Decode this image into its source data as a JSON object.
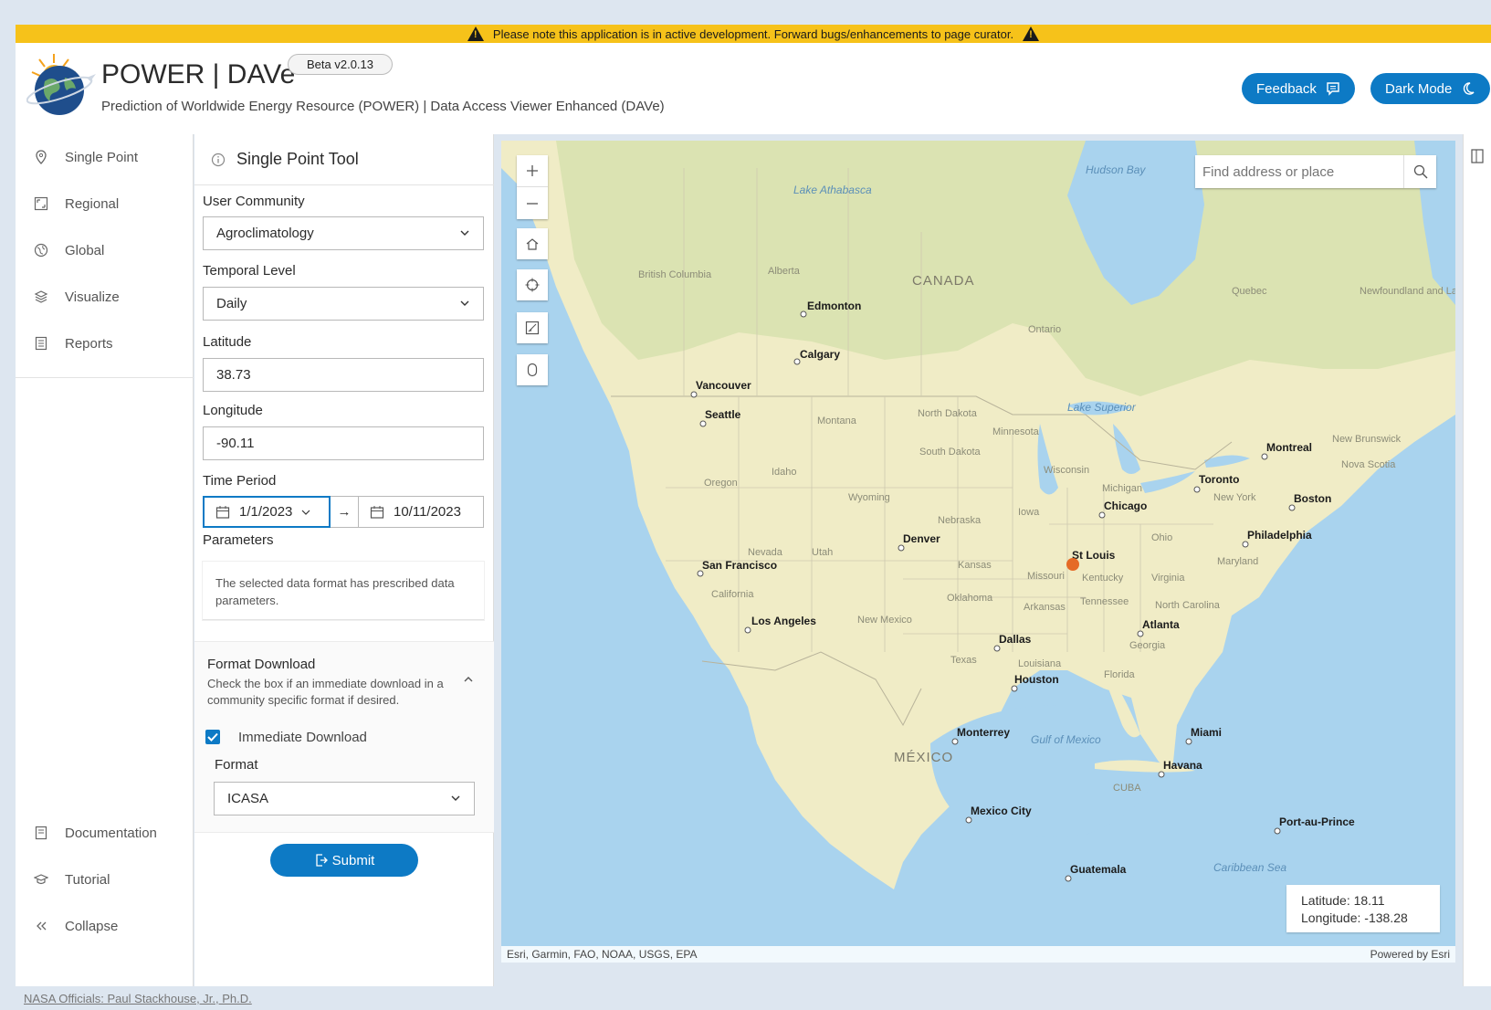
{
  "banner": {
    "text": "Please note this application is in active development. Forward bugs/enhancements to page curator."
  },
  "header": {
    "title": "POWER | DAVe",
    "beta": "Beta v2.0.13",
    "subtitle": "Prediction of Worldwide Energy Resource (POWER) | Data Access Viewer Enhanced (DAVe)",
    "feedback_label": "Feedback",
    "darkmode_label": "Dark Mode"
  },
  "sidebar": {
    "items": [
      {
        "label": "Single Point",
        "icon": "map-pin-icon"
      },
      {
        "label": "Regional",
        "icon": "region-icon"
      },
      {
        "label": "Global",
        "icon": "globe-icon"
      },
      {
        "label": "Visualize",
        "icon": "layers-icon"
      },
      {
        "label": "Reports",
        "icon": "report-icon"
      }
    ],
    "bottom": [
      {
        "label": "Documentation",
        "icon": "document-icon"
      },
      {
        "label": "Tutorial",
        "icon": "graduation-cap-icon"
      },
      {
        "label": "Collapse",
        "icon": "double-chevron-left-icon"
      }
    ]
  },
  "tool": {
    "title": "Single Point Tool",
    "user_community": {
      "label": "User Community",
      "value": "Agroclimatology"
    },
    "temporal_level": {
      "label": "Temporal Level",
      "value": "Daily"
    },
    "latitude": {
      "label": "Latitude",
      "value": "38.73"
    },
    "longitude": {
      "label": "Longitude",
      "value": "-90.11"
    },
    "time_period": {
      "label": "Time Period",
      "start": "1/1/2023",
      "end": "10/11/2023"
    },
    "parameters": {
      "label": "Parameters",
      "note": "The selected data format has prescribed data parameters."
    },
    "format_download": {
      "title": "Format Download",
      "desc": "Check the box if an immediate download in a community specific format if desired.",
      "checkbox_label": "Immediate Download",
      "checked": true,
      "format_label": "Format",
      "format_value": "ICASA"
    },
    "submit_label": "Submit"
  },
  "map": {
    "search_placeholder": "Find address or place",
    "coords": {
      "lat": "Latitude: 18.11",
      "lon": "Longitude: -138.28"
    },
    "attribution": "Esri, Garmin, FAO, NOAA, USGS, EPA",
    "powered": "Powered by Esri",
    "cities": [
      "Edmonton",
      "Calgary",
      "Vancouver",
      "Seattle",
      "San Francisco",
      "Los Angeles",
      "Denver",
      "Dallas",
      "Houston",
      "St Louis",
      "Chicago",
      "Toronto",
      "Montreal",
      "Boston",
      "Philadelphia",
      "Atlanta",
      "Miami",
      "Havana",
      "Monterrey",
      "Mexico City",
      "Guatemala",
      "Port-au-Prince"
    ],
    "regions": [
      "British Columbia",
      "Alberta",
      "Ontario",
      "Quebec",
      "Newfoundland and Labrador",
      "Montana",
      "North Dakota",
      "South Dakota",
      "Minnesota",
      "Wisconsin",
      "Michigan",
      "Oregon",
      "Idaho",
      "Wyoming",
      "Nebraska",
      "Iowa",
      "Nevada",
      "Utah",
      "California",
      "Kansas",
      "Missouri",
      "Kentucky",
      "Virginia",
      "Ohio",
      "New York",
      "Oklahoma",
      "Arkansas",
      "Tennessee",
      "North Carolina",
      "New Mexico",
      "Georgia",
      "Texas",
      "Louisiana",
      "Florida",
      "New Brunswick",
      "Nova Scotia",
      "Maryland"
    ],
    "countries": [
      "CANADA",
      "MÉXICO",
      "CUBA"
    ],
    "waters": [
      "Hudson Bay",
      "Lake Athabasca",
      "Lake Superior",
      "Gulf of Mexico",
      "Caribbean Sea"
    ],
    "colors": {
      "ocean": "#a9d3ee",
      "land": "#f0ecc6",
      "forest": "#dbe3b2",
      "marker": "#e56a26"
    }
  },
  "footer": {
    "link": "NASA Officials: Paul Stackhouse, Jr., Ph.D."
  },
  "colors": {
    "accent": "#0d7ac5",
    "banner": "#f6c21a"
  }
}
